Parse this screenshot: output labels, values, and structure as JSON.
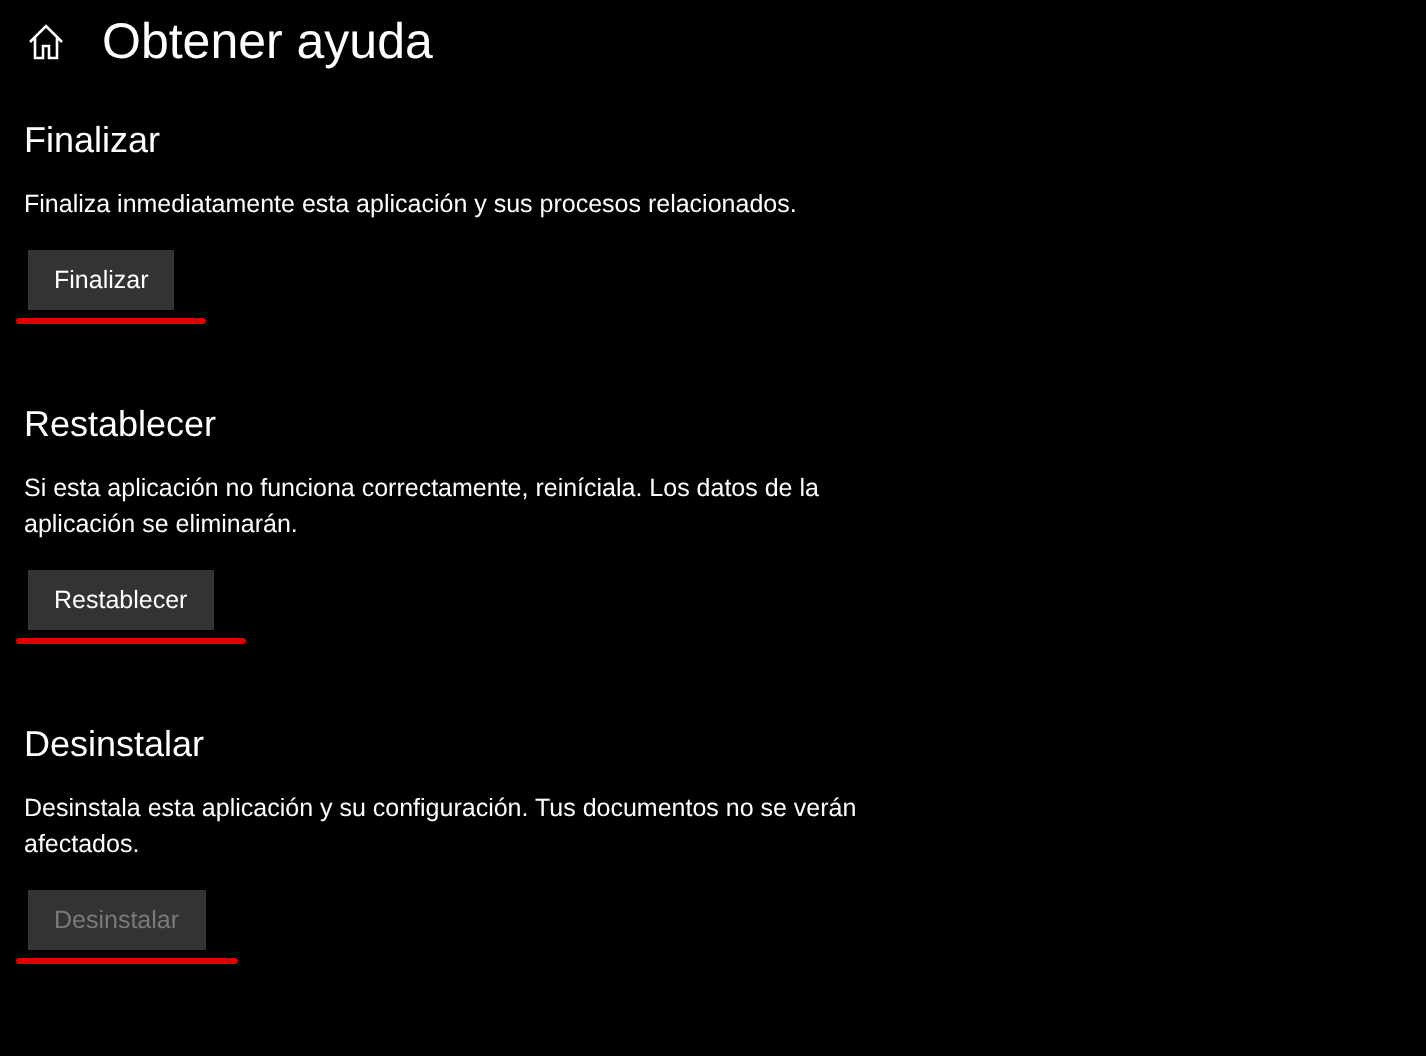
{
  "header": {
    "title": "Obtener ayuda"
  },
  "sections": [
    {
      "heading": "Finalizar",
      "description": "Finaliza inmediatamente esta aplicación y sus procesos relacionados.",
      "button": {
        "label": "Finalizar",
        "disabled": false,
        "underlined": true
      }
    },
    {
      "heading": "Restablecer",
      "description": "Si esta aplicación no funciona correctamente, reiníciala. Los datos de la aplicación se eliminarán.",
      "button": {
        "label": "Restablecer",
        "disabled": false,
        "underlined": true
      }
    },
    {
      "heading": "Desinstalar",
      "description": "Desinstala esta aplicación y su configuración. Tus documentos no se verán afectados.",
      "button": {
        "label": "Desinstalar",
        "disabled": true,
        "underlined": true
      }
    }
  ]
}
